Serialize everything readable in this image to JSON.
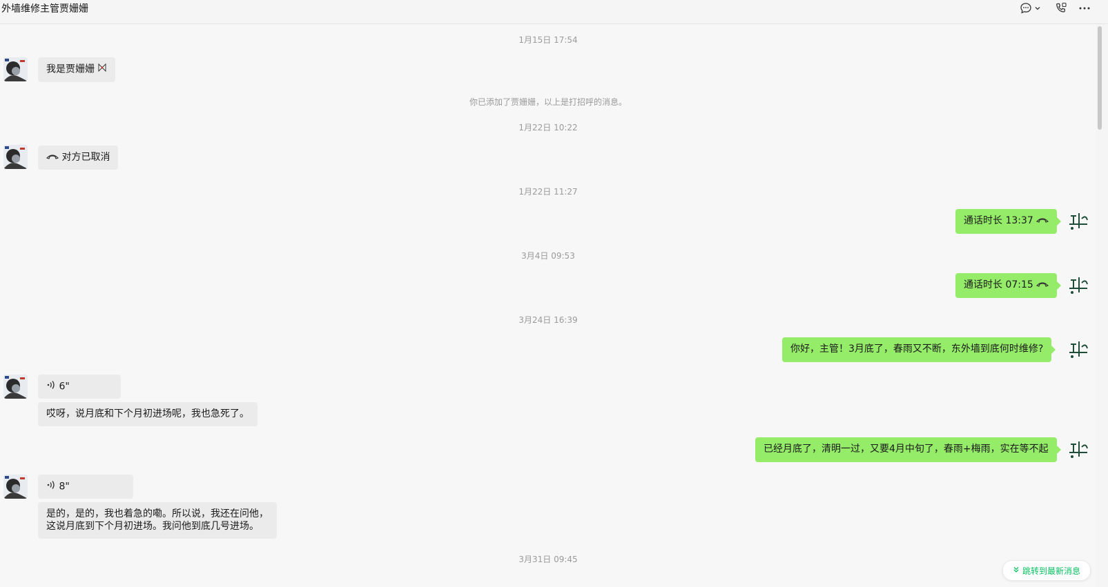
{
  "window": {
    "title": "外墙维修主管贾姗姗",
    "icons": [
      "chat-bubble-icon",
      "chevron-down-icon",
      "phone-icon",
      "more-icon"
    ]
  },
  "messages": {
    "t1": "1月15日 17:54",
    "m1": "我是贾姗姗",
    "sys1": "你已添加了贾姗姗，以上是打招呼的消息。",
    "t2": "1月22日 10:22",
    "m2": "对方已取消",
    "t3": "1月22日 11:27",
    "m3": "通话时长 13:37",
    "t4": "3月4日 09:53",
    "m4": "通话时长 07:15",
    "t5": "3月24日 16:39",
    "m5": "你好，主管！3月底了，春雨又不断，东外墙到底何时维修?",
    "v1": "6\"",
    "m6": "哎呀，说月底和下个月初进场呢，我也急死了。",
    "m7": "已经月底了，清明一过，又要4月中旬了，春雨+梅雨，实在等不起",
    "v2": "8\"",
    "m8a": "是的，是的，我也着急的嘞。所以说，我还在问他，",
    "m8b": "这说月底到下个月初进场。我问他到底几号进场。",
    "t6": "3月31日 09:45"
  },
  "jump": {
    "label": "跳转到最新消息",
    "icon": "double-chevron-down-icon"
  },
  "colors": {
    "outgoing_bubble": "#95ec69",
    "incoming_bubble": "#ebebeb",
    "accent": "#07c160"
  }
}
